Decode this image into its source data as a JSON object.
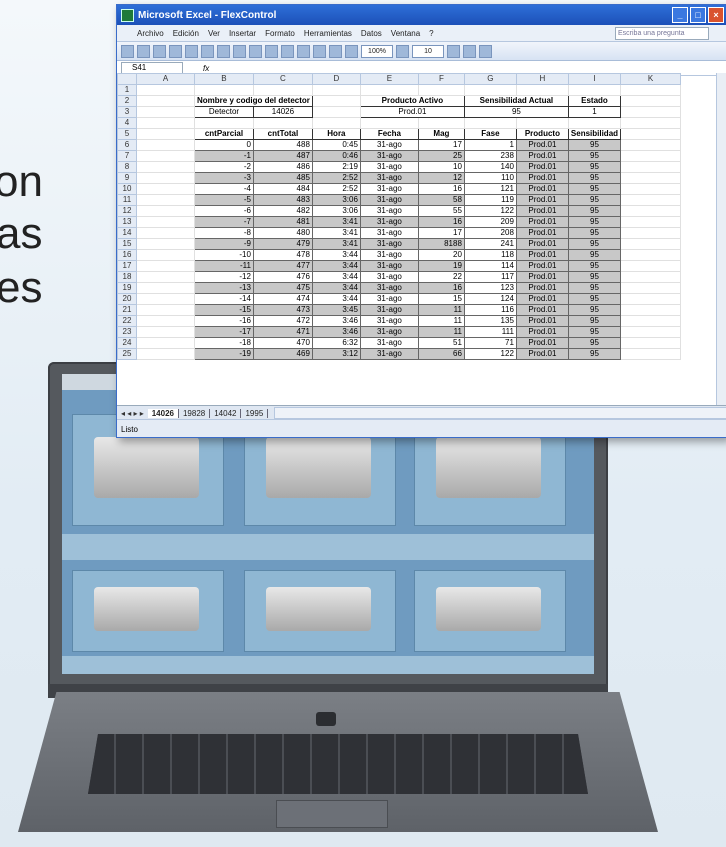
{
  "background_text": [
    "on",
    "as",
    "es"
  ],
  "window": {
    "title": "Microsoft Excel - FlexControl",
    "menu": [
      "Archivo",
      "Edición",
      "Ver",
      "Insertar",
      "Formato",
      "Herramientas",
      "Datos",
      "Ventana",
      "?"
    ],
    "help_placeholder": "Escriba una pregunta",
    "zoom": "100%",
    "font_size": "10",
    "name_box": "S41",
    "fx_label": "fx",
    "status": "Listo"
  },
  "sheet": {
    "columns": [
      "A",
      "B",
      "C",
      "D",
      "E",
      "F",
      "G",
      "H",
      "I",
      "K"
    ],
    "header_block": {
      "detector_title": "Nombre y codigo del detector",
      "producto_title": "Producto Activo",
      "sens_title": "Sensibilidad Actual",
      "estado_title": "Estado",
      "detector_label": "Detector",
      "detector_code": "14026",
      "producto_value": "Prod.01",
      "sens_value": "95",
      "estado_value": "1"
    },
    "table_headers": [
      "cntParcial",
      "cntTotal",
      "Hora",
      "Fecha",
      "Mag",
      "Fase",
      "Producto",
      "Sensibilidad"
    ],
    "rows": [
      [
        "0",
        "488",
        "0:45",
        "31-ago",
        "17",
        "1",
        "Prod.01",
        "95"
      ],
      [
        "-1",
        "487",
        "0:46",
        "31-ago",
        "25",
        "238",
        "Prod.01",
        "95"
      ],
      [
        "-2",
        "486",
        "2:19",
        "31-ago",
        "10",
        "140",
        "Prod.01",
        "95"
      ],
      [
        "-3",
        "485",
        "2:52",
        "31-ago",
        "12",
        "110",
        "Prod.01",
        "95"
      ],
      [
        "-4",
        "484",
        "2:52",
        "31-ago",
        "16",
        "121",
        "Prod.01",
        "95"
      ],
      [
        "-5",
        "483",
        "3:06",
        "31-ago",
        "58",
        "119",
        "Prod.01",
        "95"
      ],
      [
        "-6",
        "482",
        "3:06",
        "31-ago",
        "55",
        "122",
        "Prod.01",
        "95"
      ],
      [
        "-7",
        "481",
        "3:41",
        "31-ago",
        "16",
        "209",
        "Prod.01",
        "95"
      ],
      [
        "-8",
        "480",
        "3:41",
        "31-ago",
        "17",
        "208",
        "Prod.01",
        "95"
      ],
      [
        "-9",
        "479",
        "3:41",
        "31-ago",
        "8188",
        "241",
        "Prod.01",
        "95"
      ],
      [
        "-10",
        "478",
        "3:44",
        "31-ago",
        "20",
        "118",
        "Prod.01",
        "95"
      ],
      [
        "-11",
        "477",
        "3:44",
        "31-ago",
        "19",
        "114",
        "Prod.01",
        "95"
      ],
      [
        "-12",
        "476",
        "3:44",
        "31-ago",
        "22",
        "117",
        "Prod.01",
        "95"
      ],
      [
        "-13",
        "475",
        "3:44",
        "31-ago",
        "16",
        "123",
        "Prod.01",
        "95"
      ],
      [
        "-14",
        "474",
        "3:44",
        "31-ago",
        "15",
        "124",
        "Prod.01",
        "95"
      ],
      [
        "-15",
        "473",
        "3:45",
        "31-ago",
        "11",
        "116",
        "Prod.01",
        "95"
      ],
      [
        "-16",
        "472",
        "3:46",
        "31-ago",
        "11",
        "135",
        "Prod.01",
        "95"
      ],
      [
        "-17",
        "471",
        "3:46",
        "31-ago",
        "11",
        "111",
        "Prod.01",
        "95"
      ],
      [
        "-18",
        "470",
        "6:32",
        "31-ago",
        "51",
        "71",
        "Prod.01",
        "95"
      ],
      [
        "-19",
        "469",
        "3:12",
        "31-ago",
        "66",
        "122",
        "Prod.01",
        "95"
      ]
    ],
    "tabs": [
      "14026",
      "19828",
      "14042",
      "1995"
    ],
    "active_tab": 0
  },
  "colors": {
    "title_bar": "#1c50b8",
    "accent": "#3a6cc9",
    "shade": "#c8c8c8"
  }
}
